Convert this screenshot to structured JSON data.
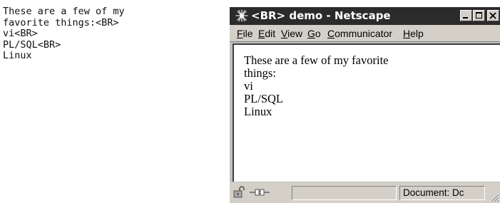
{
  "source_code": {
    "lines": [
      "These are a few of my",
      "favorite things:<BR>",
      "vi<BR>",
      "PL/SQL<BR>",
      "Linux"
    ]
  },
  "window": {
    "title": "<BR> demo - Netscape",
    "app_icon": "netscape-icon",
    "controls": {
      "minimize_icon": "minimize-icon",
      "maximize_icon": "maximize-icon",
      "close_icon": "close-icon"
    }
  },
  "menu": {
    "items": [
      {
        "accel": "F",
        "rest": "ile"
      },
      {
        "accel": "E",
        "rest": "dit"
      },
      {
        "accel": "V",
        "rest": "iew"
      },
      {
        "accel": "G",
        "rest": "o"
      },
      {
        "accel": "C",
        "rest": "ommunicator"
      },
      {
        "accel": "H",
        "rest": "elp"
      }
    ]
  },
  "content": {
    "lines": [
      "These are a few of my favorite",
      "things:",
      "vi",
      "PL/SQL",
      "Linux"
    ]
  },
  "status": {
    "lock_icon": "lock-icon",
    "connection_icon": "connection-plug-icon",
    "message": "Document: Dc"
  },
  "colors": {
    "titlebar": "#2b2b2b",
    "chrome": "#d4d0c8",
    "page_background": "#ffffff"
  }
}
